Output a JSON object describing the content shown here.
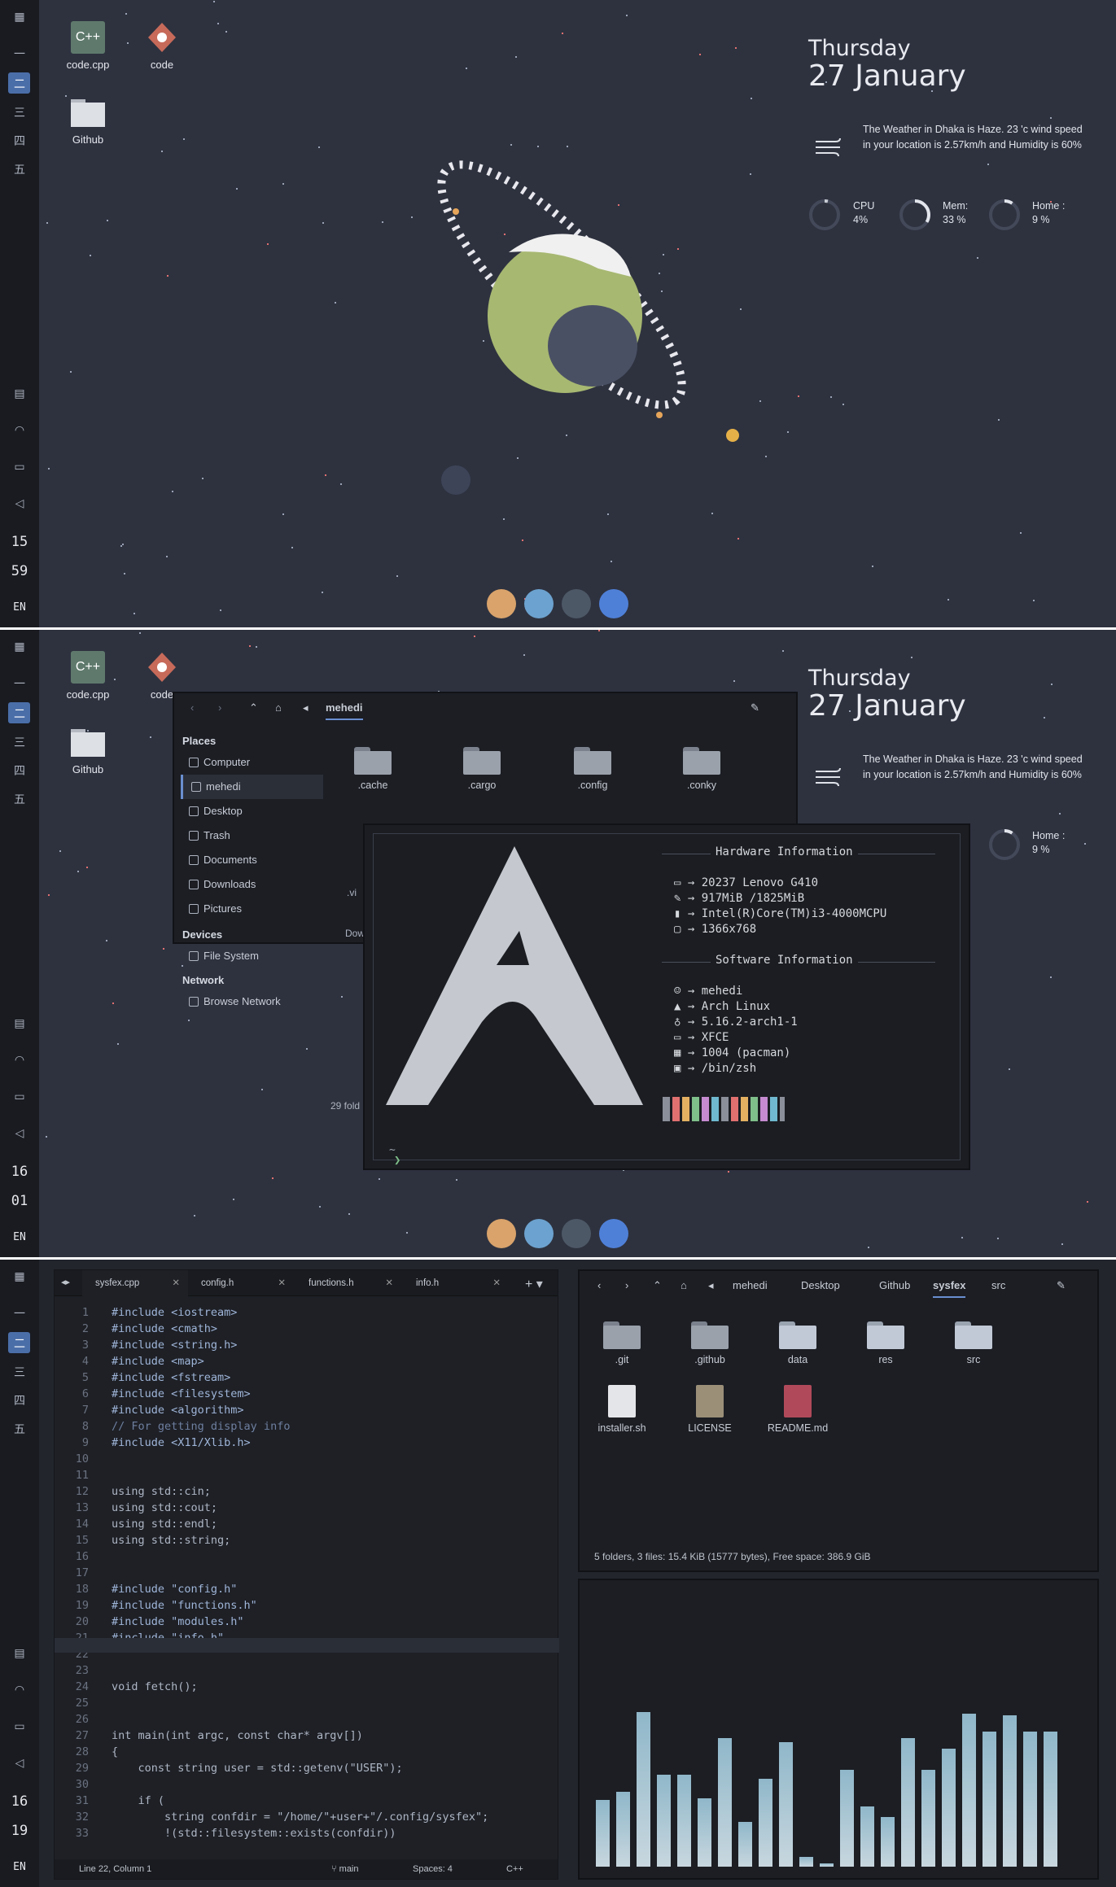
{
  "workspace_icons": [
    "一",
    "二",
    "三",
    "四",
    "五"
  ],
  "panels": [
    {
      "clock": {
        "hour": "15",
        "minute": "59"
      },
      "lang": "EN"
    },
    {
      "clock": {
        "hour": "16",
        "minute": "01"
      },
      "lang": "EN"
    },
    {
      "clock": {
        "hour": "16",
        "minute": "19"
      },
      "lang": "EN"
    }
  ],
  "desktop_icons": [
    {
      "label": "code.cpp"
    },
    {
      "label": "code"
    },
    {
      "label": "Github"
    }
  ],
  "widget": {
    "day": "Thursday",
    "date": "27 January",
    "weather": "The Weather in Dhaka is Haze. 23 'c wind speed in your location is 2.57km/h and Humidity is 60%",
    "cpu_label": "CPU",
    "cpu_value": "4%",
    "mem_label": "Mem:",
    "mem_value": "33 %",
    "home_label": "Home :",
    "home_value": "9 %"
  },
  "file_manager": {
    "location": "mehedi",
    "places_header": "Places",
    "places": [
      "Computer",
      "mehedi",
      "Desktop",
      "Trash",
      "Documents",
      "Downloads",
      "Pictures"
    ],
    "devices_header": "Devices",
    "devices": [
      "File System"
    ],
    "network_header": "Network",
    "network": [
      "Browse Network"
    ],
    "folders": [
      ".cache",
      ".cargo",
      ".config",
      ".conky"
    ],
    "partial_labels": [
      ".vi",
      "Dow"
    ],
    "status": "29 fold"
  },
  "neofetch": {
    "hw_title": "Hardware Information",
    "hw": [
      "20237 Lenovo G410",
      "917MiB /1825MiB",
      "Intel(R)Core(TM)i3-4000MCPU",
      "1366x768"
    ],
    "sw_title": "Software Information",
    "sw": [
      "mehedi",
      "Arch Linux",
      "5.16.2-arch1-1",
      "XFCE",
      "1004 (pacman)",
      "/bin/zsh"
    ],
    "prompt_dir": "~",
    "prompt": "❯"
  },
  "editor": {
    "tabs": [
      "sysfex.cpp",
      "config.h",
      "functions.h",
      "info.h"
    ],
    "lines": [
      [
        "1",
        "#include <iostream>"
      ],
      [
        "2",
        "#include <cmath>"
      ],
      [
        "3",
        "#include <string.h>"
      ],
      [
        "4",
        "#include <map>"
      ],
      [
        "5",
        "#include <fstream>"
      ],
      [
        "6",
        "#include <filesystem>"
      ],
      [
        "7",
        "#include <algorithm>"
      ],
      [
        "8",
        "// For getting display info"
      ],
      [
        "9",
        "#include <X11/Xlib.h>"
      ],
      [
        "10",
        ""
      ],
      [
        "11",
        ""
      ],
      [
        "12",
        "using std::cin;"
      ],
      [
        "13",
        "using std::cout;"
      ],
      [
        "14",
        "using std::endl;"
      ],
      [
        "15",
        "using std::string;"
      ],
      [
        "16",
        ""
      ],
      [
        "17",
        ""
      ],
      [
        "18",
        "#include \"config.h\""
      ],
      [
        "19",
        "#include \"functions.h\""
      ],
      [
        "20",
        "#include \"modules.h\""
      ],
      [
        "21",
        "#include \"info.h\""
      ],
      [
        "22",
        ""
      ],
      [
        "23",
        ""
      ],
      [
        "24",
        "void fetch();"
      ],
      [
        "25",
        ""
      ],
      [
        "26",
        ""
      ],
      [
        "27",
        "int main(int argc, const char* argv[])"
      ],
      [
        "28",
        "{"
      ],
      [
        "29",
        "    const string user = std::getenv(\"USER\");"
      ],
      [
        "30",
        ""
      ],
      [
        "31",
        "    if ("
      ],
      [
        "32",
        "        string confdir = \"/home/\"+user+\"/.config/sysfex\";"
      ],
      [
        "33",
        "        !(std::filesystem::exists(confdir))"
      ]
    ],
    "status_pos": "Line 22, Column 1",
    "branch": "main",
    "spaces": "Spaces: 4",
    "lang": "C++"
  },
  "file_manager2": {
    "crumbs": [
      "mehedi",
      "Desktop",
      "Github",
      "sysfex",
      "src"
    ],
    "items": [
      ".git",
      ".github",
      "data",
      "res",
      "src"
    ],
    "files": [
      "installer.sh",
      "LICENSE",
      "README.md"
    ],
    "status": "5 folders, 3 files: 15.4 KiB (15777 bytes), Free space: 386.9 GiB"
  },
  "visualizer": [
    0.4,
    0.45,
    0.93,
    0.55,
    0.55,
    0.41,
    0.77,
    0.27,
    0.53,
    0.75,
    0.06,
    0.02,
    0.58,
    0.36,
    0.3,
    0.77,
    0.58,
    0.71,
    0.92,
    0.81,
    0.91,
    0.81,
    0.81
  ]
}
